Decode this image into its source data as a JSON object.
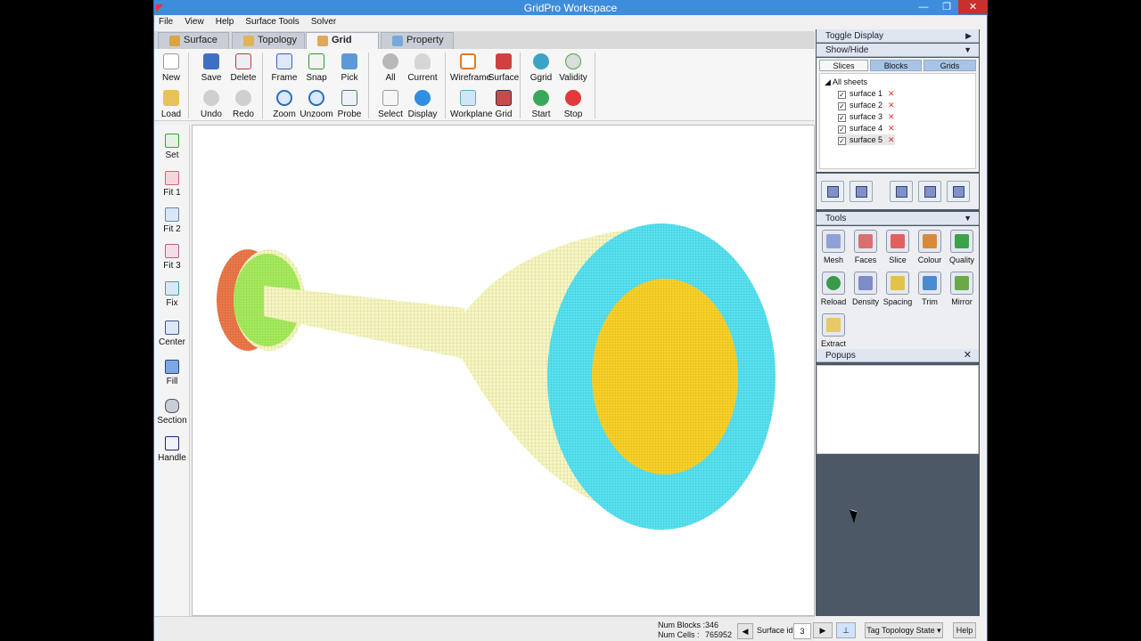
{
  "window": {
    "title": "GridPro Workspace",
    "min": "—",
    "max": "❐",
    "close": "✕",
    "icon": "app-logo-icon"
  },
  "menu": [
    "File",
    "View",
    "Help",
    "Surface Tools",
    "Solver"
  ],
  "tabs": [
    {
      "label": "Surface",
      "icon": "surface-tab-icon",
      "color": "#d9a441"
    },
    {
      "label": "Topology",
      "icon": "topology-tab-icon",
      "color": "#e0b35a"
    },
    {
      "label": "Grid",
      "icon": "grid-tab-icon",
      "color": "#e0a95a",
      "active": true
    },
    {
      "label": "Property",
      "icon": "property-tab-icon",
      "color": "#7aa8d8"
    }
  ],
  "ribbon": {
    "new": "New",
    "save": "Save",
    "delete": "Delete",
    "frame": "Frame",
    "snap": "Snap",
    "pick": "Pick",
    "all": "All",
    "current": "Current",
    "wireframe": "Wireframe",
    "surface": "Surface",
    "ggrid": "Ggrid",
    "validity": "Validity",
    "load": "Load",
    "undo": "Undo",
    "redo": "Redo",
    "zoom": "Zoom",
    "unzoom": "Unzoom",
    "probe": "Probe",
    "select": "Select",
    "display": "Display",
    "workplane": "Workplane",
    "grid": "Grid",
    "start": "Start",
    "stop": "Stop"
  },
  "left_tools": [
    "Set",
    "Fit 1",
    "Fit 2",
    "Fit 3",
    "Fix",
    "Center",
    "Fill",
    "Section",
    "Handle"
  ],
  "status": {
    "num_blocks_label": "Num Blocks :",
    "num_blocks": "346",
    "num_cells_label": "Num Cells :",
    "num_cells": "765952",
    "surface_id_label": "Surface id :",
    "surface_id": "3",
    "tag_state": "Tag Topology State",
    "help": "Help"
  },
  "right_panel": {
    "toggle_display": "Toggle Display",
    "show_hide": "Show/Hide",
    "subtabs": [
      "Slices",
      "Blocks",
      "Grids"
    ],
    "tree_root": "All sheets",
    "sheets": [
      "surface 1",
      "surface 2",
      "surface 3",
      "surface 4",
      "surface 5"
    ],
    "check": "✓",
    "tools_header": "Tools",
    "tools": [
      "Mesh",
      "Faces",
      "Slice",
      "Colour",
      "Quality",
      "Reload",
      "Density",
      "Spacing",
      "Trim",
      "Mirror",
      "Extract"
    ],
    "popups_header": "Popups",
    "popups_close": "✕"
  },
  "colors": {
    "inlet_disk": "#e8764a",
    "inlet_ring": "#8fe24a",
    "pipe": "#ecec9a",
    "outlet_ring": "#53e0ec",
    "outlet_core": "#f3d028"
  }
}
